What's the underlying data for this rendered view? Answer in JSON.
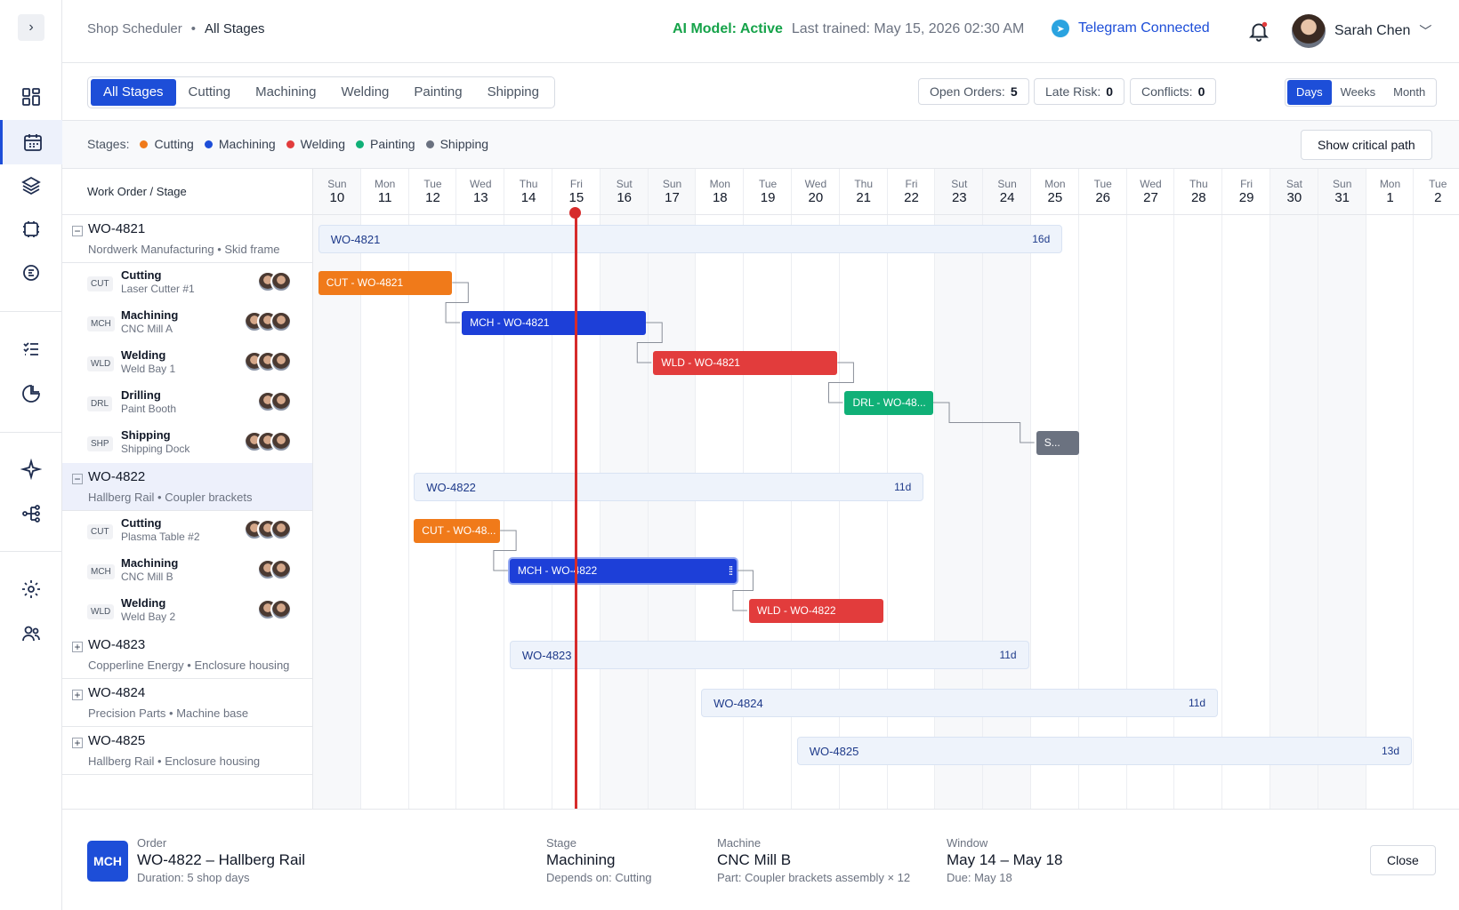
{
  "breadcrumb": {
    "root": "Shop Scheduler",
    "current": "All Stages"
  },
  "ai": {
    "status": "AI Model: Active",
    "trained": "Last trained: May 15, 2026 02:30 AM"
  },
  "telegram": {
    "label": "Telegram Connected"
  },
  "user": {
    "name": "Sarah Chen"
  },
  "stage_tabs": [
    "All Stages",
    "Cutting",
    "Machining",
    "Welding",
    "Painting",
    "Shipping"
  ],
  "stats": {
    "open_label": "Open Orders:",
    "open_value": "5",
    "late_label": "Late Risk:",
    "late_value": "0",
    "conflicts_label": "Conflicts:",
    "conflicts_value": "0"
  },
  "views": [
    "Days",
    "Weeks",
    "Month"
  ],
  "legend": {
    "label": "Stages:",
    "items": [
      {
        "name": "Cutting",
        "color": "#f07a1a"
      },
      {
        "name": "Machining",
        "color": "#1d4ed8"
      },
      {
        "name": "Welding",
        "color": "#e23c3c"
      },
      {
        "name": "Painting",
        "color": "#10b077"
      },
      {
        "name": "Shipping",
        "color": "#6b7280"
      }
    ]
  },
  "critical_path_label": "Show critical path",
  "grid_header": "Work Order / Stage",
  "days": [
    {
      "w": "Sun",
      "n": "10"
    },
    {
      "w": "Mon",
      "n": "11"
    },
    {
      "w": "Tue",
      "n": "12"
    },
    {
      "w": "Wed",
      "n": "13"
    },
    {
      "w": "Thu",
      "n": "14"
    },
    {
      "w": "Fri",
      "n": "15"
    },
    {
      "w": "Sut",
      "n": "16"
    },
    {
      "w": "Sun",
      "n": "17"
    },
    {
      "w": "Mon",
      "n": "18"
    },
    {
      "w": "Tue",
      "n": "19"
    },
    {
      "w": "Wed",
      "n": "20"
    },
    {
      "w": "Thu",
      "n": "21"
    },
    {
      "w": "Fri",
      "n": "22"
    },
    {
      "w": "Sut",
      "n": "23"
    },
    {
      "w": "Sun",
      "n": "24"
    },
    {
      "w": "Mon",
      "n": "25"
    },
    {
      "w": "Tue",
      "n": "26"
    },
    {
      "w": "Wed",
      "n": "27"
    },
    {
      "w": "Thu",
      "n": "28"
    },
    {
      "w": "Fri",
      "n": "29"
    },
    {
      "w": "Sat",
      "n": "30"
    },
    {
      "w": "Sun",
      "n": "31"
    },
    {
      "w": "Mon",
      "n": "1"
    },
    {
      "w": "Tue",
      "n": "2"
    }
  ],
  "orders": [
    {
      "id": "WO-4821",
      "sub": "Nordwerk Manufacturing • Skid frame",
      "sign": "−",
      "summary": "WO-4821",
      "duration": "16d",
      "stages": [
        {
          "code": "CUT",
          "name": "Cutting",
          "machine": "Laser Cutter #1",
          "bar": "CUT - WO-4821",
          "color": "#f07a1a",
          "people": 2
        },
        {
          "code": "MCH",
          "name": "Machining",
          "machine": "CNC Mill A",
          "bar": "MCH - WO-4821",
          "color": "#1d3fd8",
          "people": 3
        },
        {
          "code": "WLD",
          "name": "Welding",
          "machine": "Weld Bay 1",
          "bar": "WLD - WO-4821",
          "color": "#e23c3c",
          "people": 3
        },
        {
          "code": "DRL",
          "name": "Drilling",
          "machine": "Paint Booth",
          "bar": "DRL - WO-48...",
          "color": "#10b077",
          "people": 2
        },
        {
          "code": "SHP",
          "name": "Shipping",
          "machine": "Shipping Dock",
          "bar": "S...",
          "color": "#6b7280",
          "people": 3
        }
      ]
    },
    {
      "id": "WO-4822",
      "sub": "Hallberg Rail • Coupler brackets",
      "sign": "−",
      "summary": "WO-4822",
      "duration": "11d",
      "stages": [
        {
          "code": "CUT",
          "name": "Cutting",
          "machine": "Plasma Table #2",
          "bar": "CUT - WO-48...",
          "color": "#f07a1a",
          "people": 3
        },
        {
          "code": "MCH",
          "name": "Machining",
          "machine": "CNC Mill B",
          "bar": "MCH - WO-4822",
          "color": "#1d3fd8",
          "people": 2
        },
        {
          "code": "WLD",
          "name": "Welding",
          "machine": "Weld Bay 2",
          "bar": "WLD - WO-4822",
          "color": "#e23c3c",
          "people": 2
        }
      ]
    },
    {
      "id": "WO-4823",
      "sub": "Copperline Energy • Enclosure housing",
      "sign": "+",
      "summary": "WO-4823",
      "duration": "11d",
      "stages": []
    },
    {
      "id": "WO-4824",
      "sub": "Precision Parts • Machine base",
      "sign": "+",
      "summary": "WO-4824",
      "duration": "11d",
      "stages": []
    },
    {
      "id": "WO-4825",
      "sub": "Hallberg Rail • Enclosure housing",
      "sign": "+",
      "summary": "WO-4825",
      "duration": "13d",
      "stages": []
    }
  ],
  "detail": {
    "icon": "MCH",
    "order_h": "Order",
    "order_v": "WO-4822 – Hallberg Rail",
    "order_s": "Duration: 5 shop days",
    "stage_h": "Stage",
    "stage_v": "Machining",
    "stage_s": "Depends on: Cutting",
    "machine_h": "Machine",
    "machine_v": "CNC Mill B",
    "machine_s": "Part: Coupler brackets assembly × 12",
    "window_h": "Window",
    "window_v": "May 14 – May 18",
    "window_s": "Due: May 18",
    "close": "Close"
  }
}
